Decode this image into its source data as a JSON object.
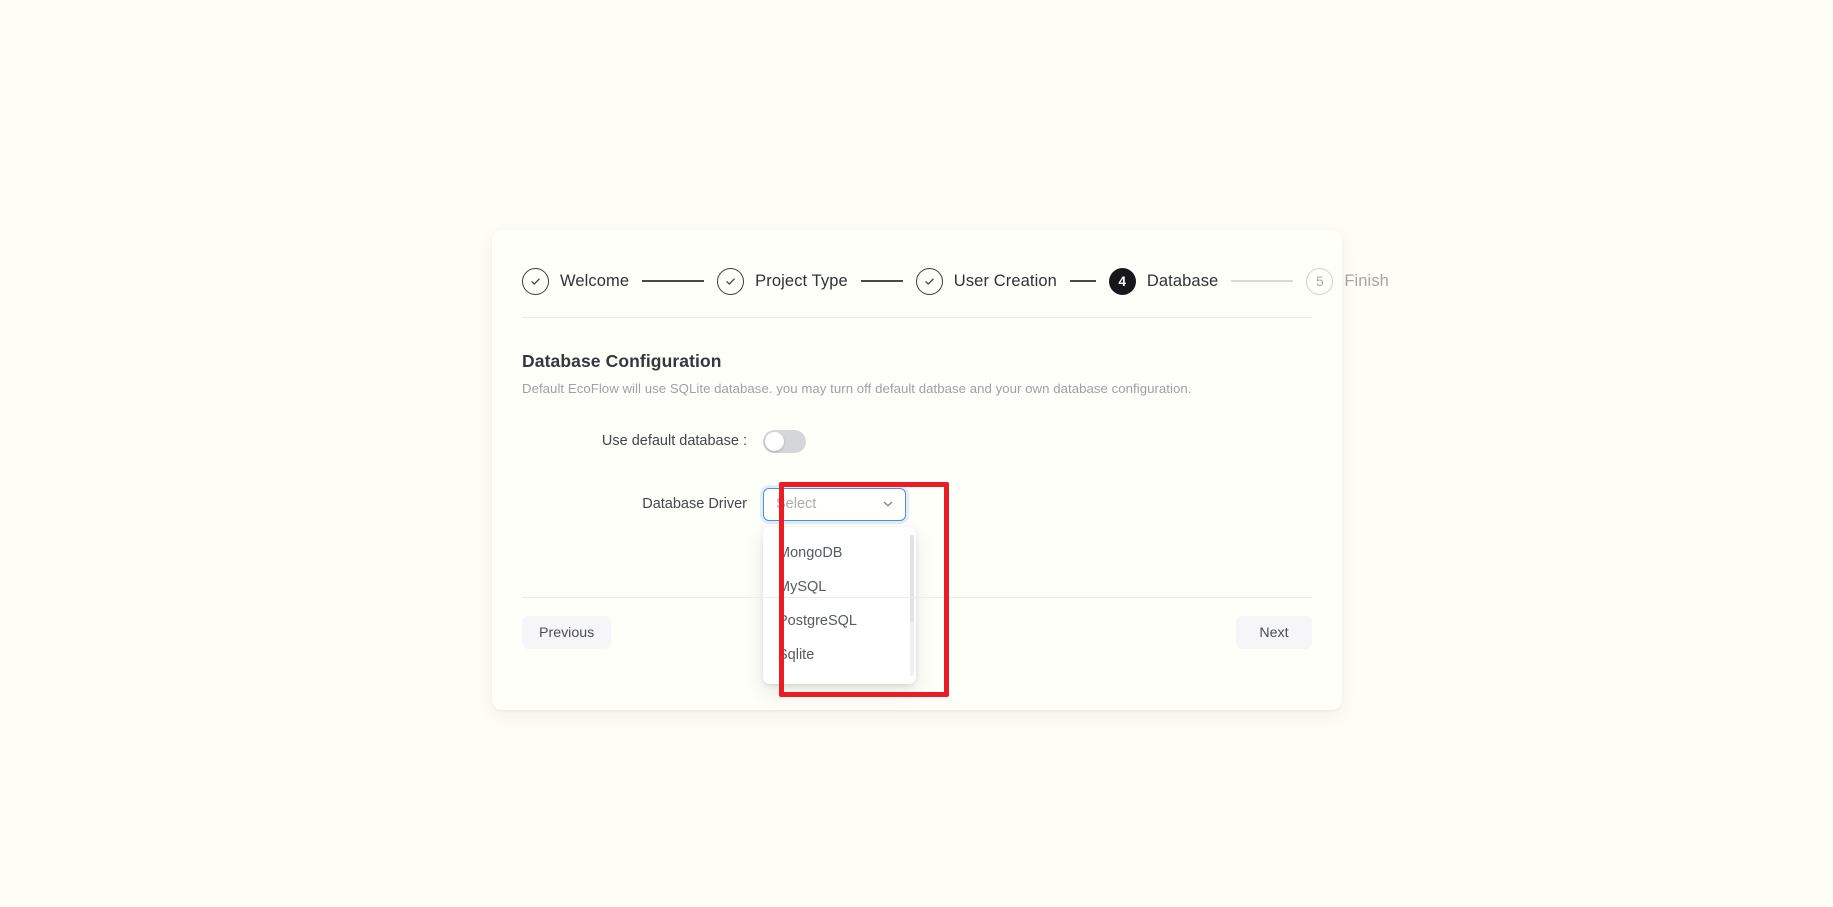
{
  "page": {
    "background_color": "#fdfdf5",
    "card_background_color": "#fffffa"
  },
  "stepper": {
    "steps": [
      {
        "index": "1",
        "label": "Welcome",
        "state": "done",
        "marker": "check-icon"
      },
      {
        "index": "2",
        "label": "Project Type",
        "state": "done",
        "marker": "check-icon"
      },
      {
        "index": "3",
        "label": "User Creation",
        "state": "done",
        "marker": "check-icon"
      },
      {
        "index": "4",
        "label": "Database",
        "state": "current",
        "marker": "4"
      },
      {
        "index": "5",
        "label": "Finish",
        "state": "pending",
        "marker": "5"
      }
    ],
    "current_step_number": "4",
    "current_badge_color": "#18181b"
  },
  "section": {
    "title": "Database Configuration",
    "description": "Default EcoFlow will use SQLite database. you may turn off default datbase and your own database configuration."
  },
  "form": {
    "default_database": {
      "label": "Use default database :",
      "enabled": false,
      "track_color": "#d5d6d8"
    },
    "database_driver": {
      "label": "Database Driver",
      "selected_value": "",
      "placeholder": "Select",
      "expanded": true,
      "focus_color": "#4a90e2",
      "options": [
        "MongoDB",
        "MySQL",
        "PostgreSQL",
        "Sqlite"
      ]
    }
  },
  "footer": {
    "previous_label": "Previous",
    "next_label": "Next"
  },
  "annotation": {
    "highlight_color": "#ec1c24"
  }
}
